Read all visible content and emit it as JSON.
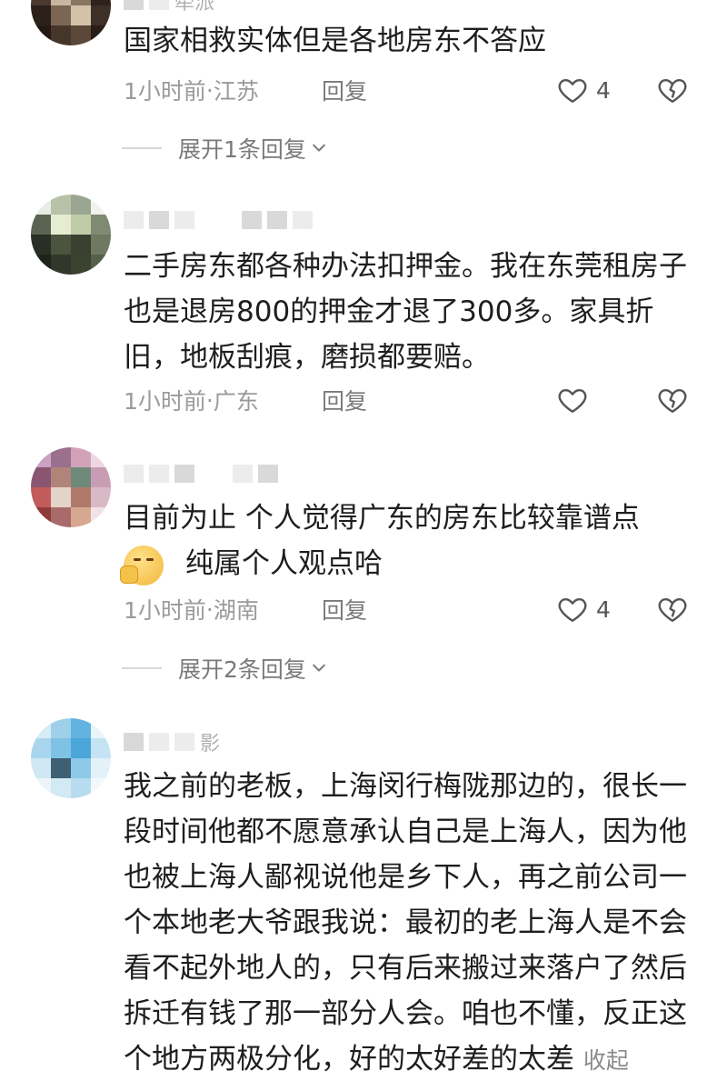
{
  "comments": [
    {
      "text": "国家相救实体但是各地房东不答应",
      "time": "1小时前",
      "location": "江苏",
      "reply_label": "回复",
      "likes": "4",
      "expand": "展开1条回复",
      "username_partial": "牵派"
    },
    {
      "text": "二手房东都各种办法扣押金。我在东莞租房子也是退房800的押金才退了300多。家具折旧，地板刮痕，磨损都要赔。",
      "time": "1小时前",
      "location": "广东",
      "reply_label": "回复",
      "likes": ""
    },
    {
      "text_line1": "目前为止 个人觉得广东的房东比较靠谱点",
      "text_line2": "纯属个人观点哈",
      "emoji": "think-emoji",
      "time": "1小时前",
      "location": "湖南",
      "reply_label": "回复",
      "likes": "4",
      "expand": "展开2条回复"
    },
    {
      "username_partial": "影",
      "text": "我之前的老板，上海闵行梅陇那边的，很长一段时间他都不愿意承认自己是上海人，因为他也被上海人鄙视说他是乡下人，再之前公司一个本地老大爷跟我说：最初的老上海人是不会看不起外地人的，只有后来搬过来落户了然后拆迁有钱了那一部分人会。咱也不懂，反正这个地方两极分化，好的太好差的太差",
      "collapse_label": "收起"
    }
  ],
  "separator": " · ",
  "colors": {
    "meta": "#9a9a9a",
    "text": "#1e1e1e"
  }
}
